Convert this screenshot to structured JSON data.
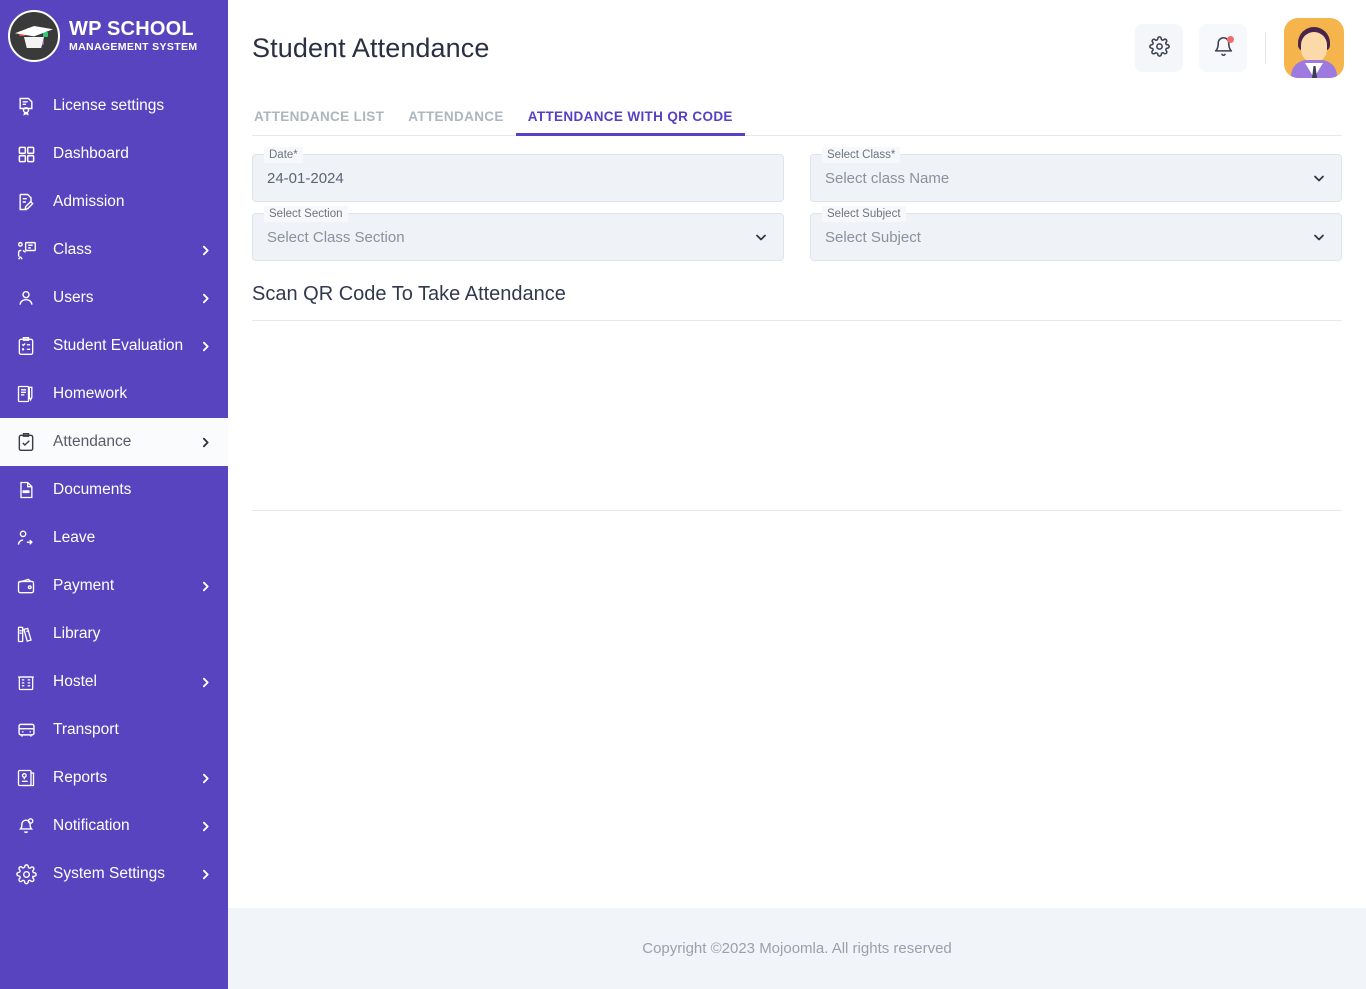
{
  "brand": {
    "logo_icon": "graduation-cap-logo",
    "title": "WP SCHOOL",
    "subtitle": "MANAGEMENT SYSTEM"
  },
  "colors": {
    "sidebar_bg": "#5844BE",
    "accent": "#5542C3",
    "field_bg": "#eff2f7",
    "footer_bg": "#f1f5f9",
    "notification_dot": "#f46a6a",
    "avatar_bg": "#f5b44c"
  },
  "sidebar": {
    "items": [
      {
        "label": "License settings",
        "icon": "certificate-icon",
        "has_chevron": false,
        "active": false
      },
      {
        "label": "Dashboard",
        "icon": "grid-icon",
        "has_chevron": false,
        "active": false
      },
      {
        "label": "Admission",
        "icon": "document-edit-icon",
        "has_chevron": false,
        "active": false
      },
      {
        "label": "Class",
        "icon": "teacher-board-icon",
        "has_chevron": true,
        "active": false
      },
      {
        "label": "Users",
        "icon": "user-icon",
        "has_chevron": true,
        "active": false
      },
      {
        "label": "Student Evaluation",
        "icon": "clipboard-check-icon",
        "has_chevron": true,
        "active": false
      },
      {
        "label": "Homework",
        "icon": "notebook-pencil-icon",
        "has_chevron": false,
        "active": false
      },
      {
        "label": "Attendance",
        "icon": "clipboard-tick-icon",
        "has_chevron": true,
        "active": true
      },
      {
        "label": "Documents",
        "icon": "doc-file-icon",
        "has_chevron": false,
        "active": false
      },
      {
        "label": "Leave",
        "icon": "user-exit-icon",
        "has_chevron": false,
        "active": false
      },
      {
        "label": "Payment",
        "icon": "wallet-icon",
        "has_chevron": true,
        "active": false
      },
      {
        "label": "Library",
        "icon": "books-icon",
        "has_chevron": false,
        "active": false
      },
      {
        "label": "Hostel",
        "icon": "building-icon",
        "has_chevron": true,
        "active": false
      },
      {
        "label": "Transport",
        "icon": "bus-icon",
        "has_chevron": false,
        "active": false
      },
      {
        "label": "Reports",
        "icon": "report-icon",
        "has_chevron": true,
        "active": false
      },
      {
        "label": "Notification",
        "icon": "bell-icon",
        "has_chevron": true,
        "active": false
      },
      {
        "label": "System Settings",
        "icon": "gear-icon",
        "has_chevron": true,
        "active": false
      }
    ]
  },
  "header": {
    "title": "Student Attendance",
    "settings_icon": "gear-icon",
    "notifications_icon": "bell-icon",
    "has_notification_dot": true,
    "avatar_icon": "user-avatar"
  },
  "tabs": [
    {
      "label": "ATTENDANCE LIST",
      "active": false
    },
    {
      "label": "ATTENDANCE",
      "active": false
    },
    {
      "label": "ATTENDANCE WITH QR CODE",
      "active": true
    }
  ],
  "form": {
    "date": {
      "label": "Date*",
      "value": "24-01-2024",
      "type": "text"
    },
    "select_class": {
      "label": "Select Class*",
      "value": "Select class Name",
      "is_placeholder": true,
      "type": "select",
      "chevron_icon": "chevron-down-icon"
    },
    "select_section": {
      "label": "Select Section",
      "value": "Select Class Section",
      "is_placeholder": true,
      "type": "select",
      "chevron_icon": "chevron-down-icon"
    },
    "select_subject": {
      "label": "Select Subject",
      "value": "Select Subject",
      "is_placeholder": true,
      "type": "select",
      "chevron_icon": "chevron-down-icon"
    }
  },
  "scan_section": {
    "heading": "Scan QR Code To Take Attendance"
  },
  "footer": {
    "text": "Copyright ©2023 Mojoomla. All rights reserved"
  }
}
